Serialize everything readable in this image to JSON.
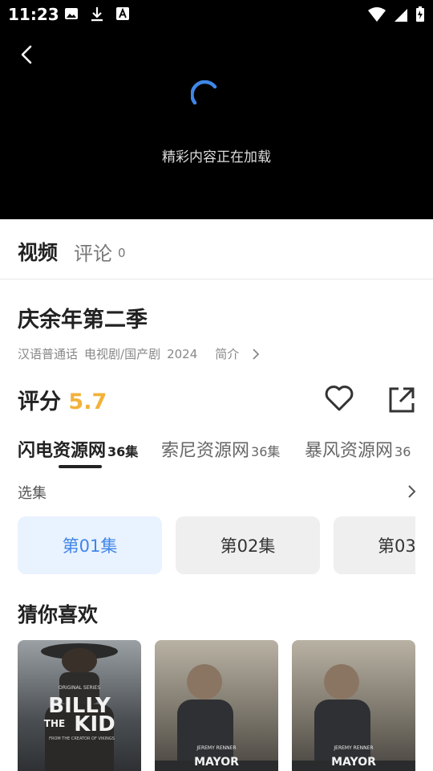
{
  "status": {
    "time": "11:23",
    "icons": [
      "image-icon",
      "download-icon",
      "a-letter-icon",
      "wifi-icon",
      "signal-icon",
      "battery-icon"
    ]
  },
  "player": {
    "loading_text": "精彩内容正在加载"
  },
  "tabs": {
    "video": "视频",
    "comment": "评论",
    "comment_count": "0"
  },
  "show": {
    "title": "庆余年第二季",
    "language": "汉语普通话",
    "genre": "电视剧/国产剧",
    "year": "2024",
    "intro_label": "简介"
  },
  "rating": {
    "label": "评分",
    "value": "5.7"
  },
  "sources": [
    {
      "name": "闪电资源网",
      "count": "36集",
      "active": true
    },
    {
      "name": "索尼资源网",
      "count": "36集",
      "active": false
    },
    {
      "name": "暴风资源网",
      "count": "36",
      "active": false
    }
  ],
  "episodes": {
    "label": "选集",
    "items": [
      "第01集",
      "第02集",
      "第03"
    ]
  },
  "recommend": {
    "title": "猜你喜欢",
    "posters": [
      {
        "lines": [
          "ORIGINAL SERIES",
          "BILLY",
          "THE",
          "KID",
          "FROM THE CREATOR OF VIKINGS"
        ]
      },
      {
        "lines": [
          "JEREMY RENNER",
          "MAYOR"
        ]
      },
      {
        "lines": [
          "JEREMY RENNER",
          "MAYOR"
        ]
      }
    ]
  },
  "colors": {
    "accent": "#3f86e8",
    "rating": "#f3b23a",
    "active_episode_bg": "#e9f2ff"
  }
}
